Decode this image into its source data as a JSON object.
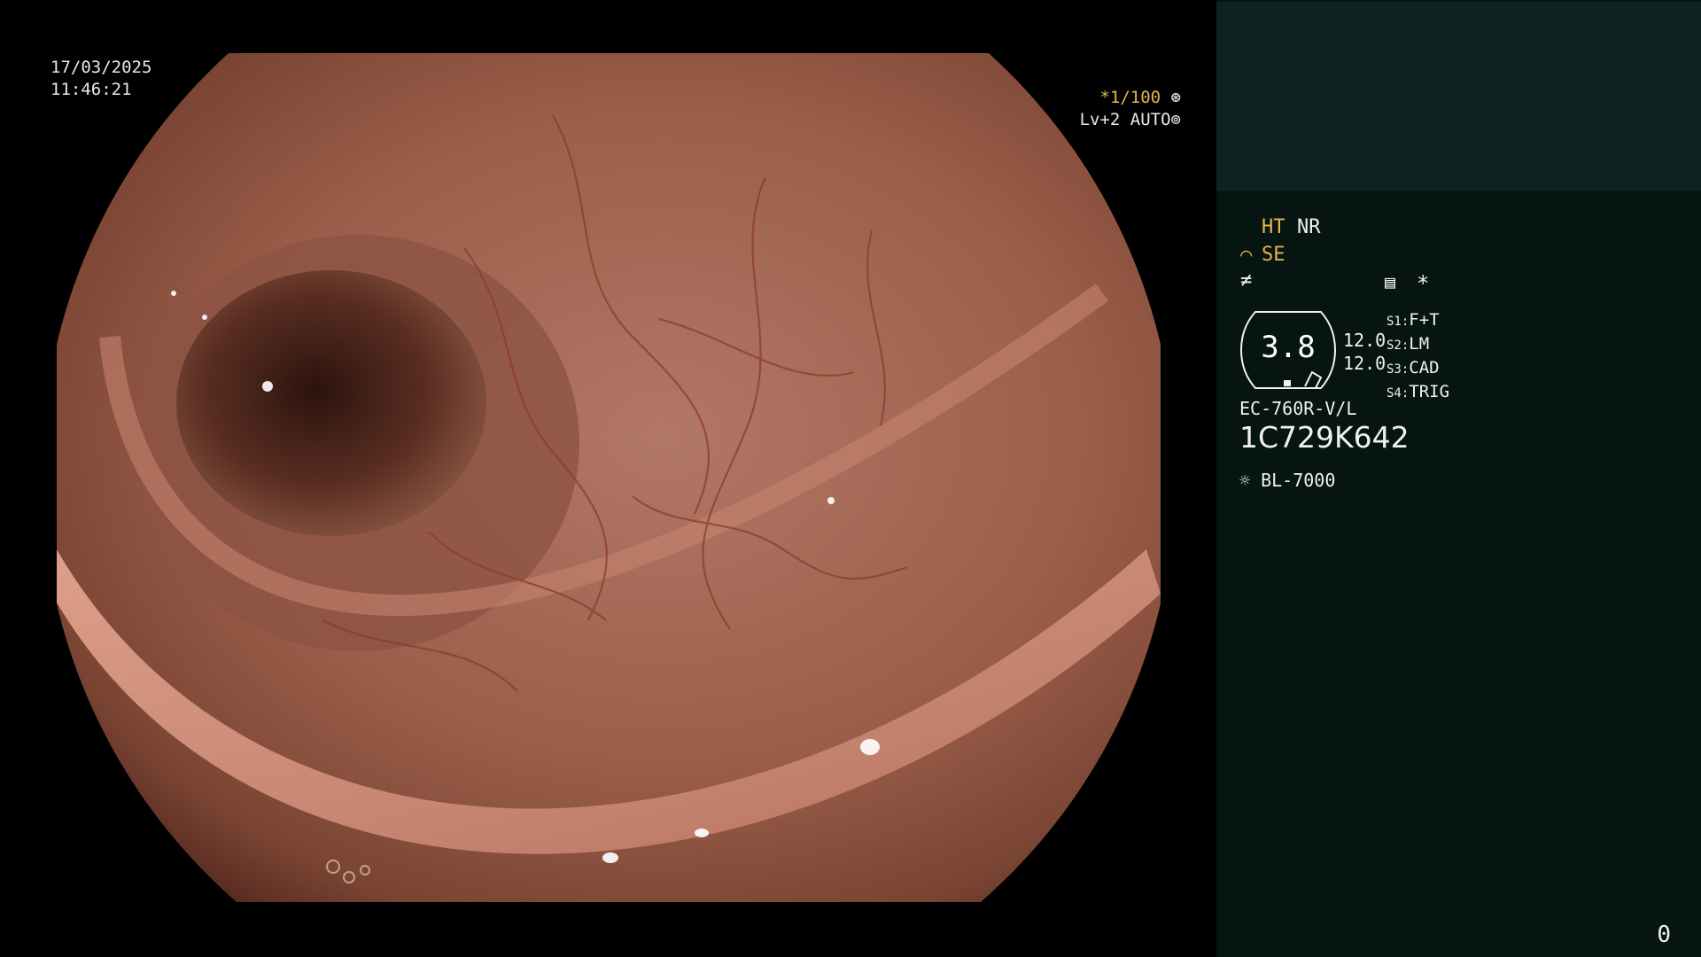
{
  "overlay": {
    "date": "17/03/2025",
    "time": "11:46:21",
    "shutter": "*1/100",
    "level": "Lv+2 AUTO"
  },
  "panel": {
    "ht": "HT",
    "nr": "NR",
    "se": "SE",
    "zoom": "3.8",
    "val1": "12.0",
    "val2": "12.0",
    "s_list": [
      {
        "key": "S1:",
        "value": "F+T"
      },
      {
        "key": "S2:",
        "value": "LM"
      },
      {
        "key": "S3:",
        "value": "CAD"
      },
      {
        "key": "S4:",
        "value": "TRIG"
      }
    ],
    "scope_model": "EC-760R-V/L",
    "serial": "1C729K642",
    "light_source": "BL-7000",
    "corner_number": "0"
  },
  "colors": {
    "amber": "#e7b34d",
    "panel_bg": "#061412",
    "panel_top_bg": "#0c2321"
  }
}
